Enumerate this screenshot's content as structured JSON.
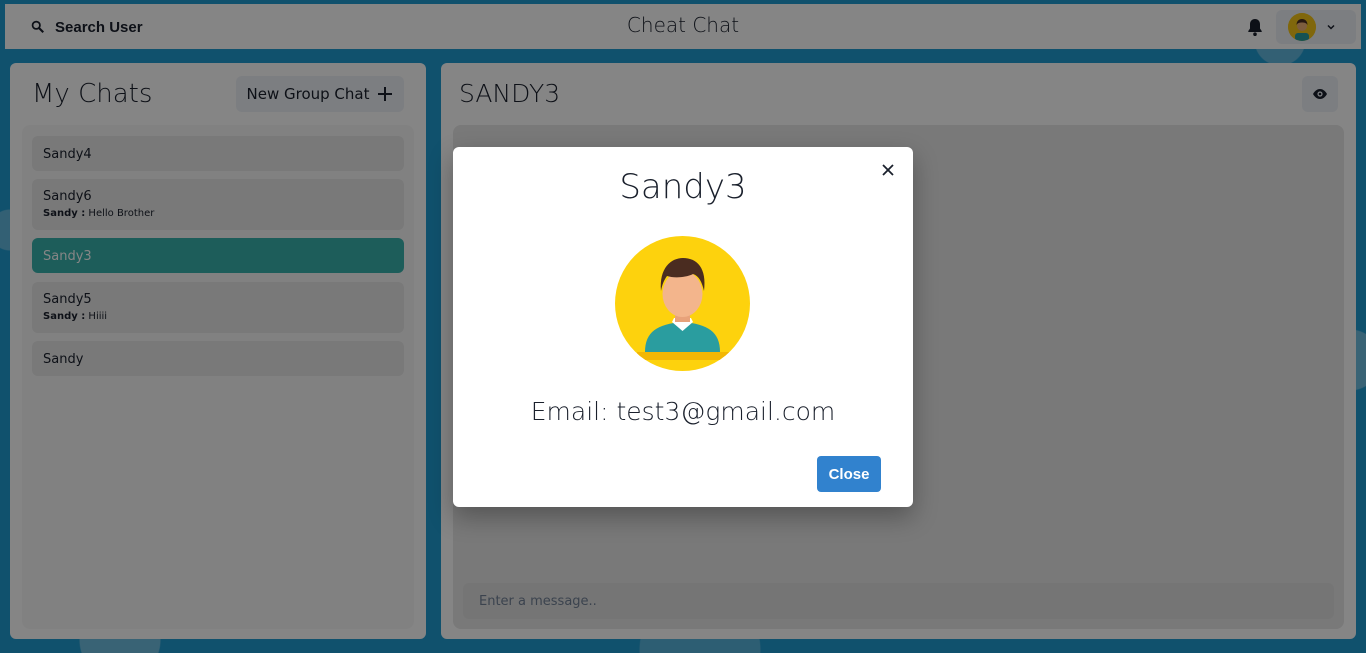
{
  "header": {
    "search_label": "Search User",
    "app_title": "Cheat Chat"
  },
  "sidebar": {
    "title": "My Chats",
    "new_group_label": "New Group Chat",
    "chats": [
      {
        "name": "Sandy4",
        "sender": "",
        "latest": ""
      },
      {
        "name": "Sandy6",
        "sender": "Sandy :",
        "latest": "Hello Brother"
      },
      {
        "name": "Sandy3",
        "sender": "",
        "latest": "",
        "selected": true
      },
      {
        "name": "Sandy5",
        "sender": "Sandy :",
        "latest": "Hiiii"
      },
      {
        "name": "Sandy",
        "sender": "",
        "latest": ""
      }
    ]
  },
  "chat": {
    "title": "SANDY3",
    "input_placeholder": "Enter a message.."
  },
  "modal": {
    "title": "Sandy3",
    "email": "Email: test3@gmail.com",
    "close_label": "Close"
  },
  "colors": {
    "accent": "#38b2ac",
    "primary_button": "#3182ce",
    "background": "#1f9bd1"
  }
}
